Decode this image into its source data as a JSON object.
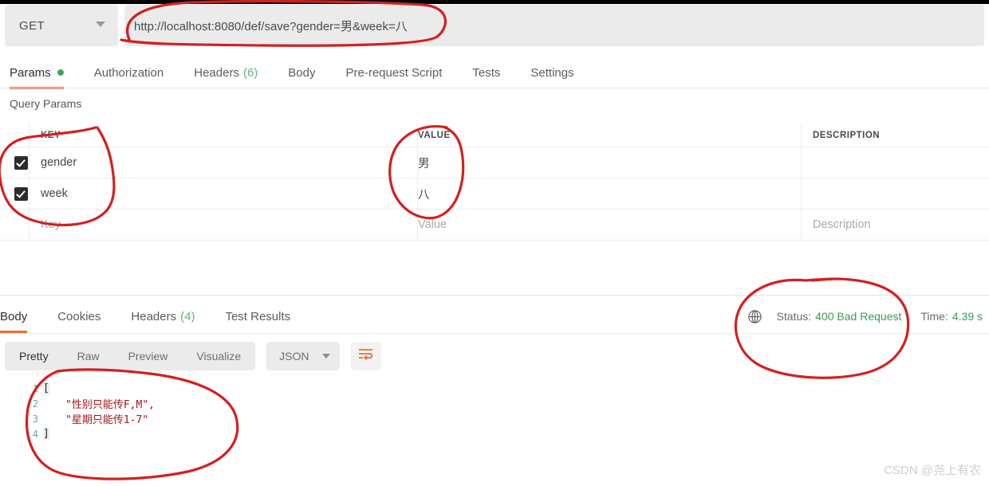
{
  "window": {
    "app": "postman-request-builder"
  },
  "request": {
    "method": "GET",
    "url": "http://localhost:8080/def/save?gender=男&week=八",
    "tabs": [
      {
        "label": "Params",
        "active": true,
        "dot": true
      },
      {
        "label": "Authorization",
        "active": false
      },
      {
        "label": "Headers",
        "count": "(6)",
        "active": false
      },
      {
        "label": "Body",
        "active": false
      },
      {
        "label": "Pre-request Script",
        "active": false
      },
      {
        "label": "Tests",
        "active": false
      },
      {
        "label": "Settings",
        "active": false
      }
    ],
    "section_label": "Query Params",
    "table": {
      "headers": [
        "KEY",
        "VALUE",
        "DESCRIPTION"
      ],
      "rows": [
        {
          "checked": true,
          "key": "gender",
          "value": "男",
          "description": ""
        },
        {
          "checked": true,
          "key": "week",
          "value": "八",
          "description": ""
        }
      ],
      "placeholder_row": {
        "key": "Key",
        "value": "Value",
        "description": "Description"
      }
    }
  },
  "response": {
    "tabs": [
      {
        "label": "Body",
        "active": true
      },
      {
        "label": "Cookies",
        "active": false
      },
      {
        "label": "Headers",
        "count": "(4)",
        "active": false
      },
      {
        "label": "Test Results",
        "active": false
      }
    ],
    "meta": {
      "globe_icon": "globe-icon",
      "status_label": "Status:",
      "status_value": "400 Bad Request",
      "time_label": "Time:",
      "time_value": "4.39 s"
    },
    "viewer": {
      "modes": [
        {
          "label": "Pretty",
          "active": true
        },
        {
          "label": "Raw",
          "active": false
        },
        {
          "label": "Preview",
          "active": false
        },
        {
          "label": "Visualize",
          "active": false
        }
      ],
      "format": "JSON",
      "wrap_icon": "wrap-lines-icon"
    },
    "body_lines": [
      {
        "n": "1",
        "bracket": "[",
        "text": ""
      },
      {
        "n": "2",
        "bracket": "",
        "text": "\"性别只能传F,M\","
      },
      {
        "n": "3",
        "bracket": "",
        "text": "\"星期只能传1-7\""
      },
      {
        "n": "4",
        "bracket": "]",
        "text": ""
      }
    ]
  },
  "watermark": "CSDN @尧上有农",
  "colors": {
    "accent_orange": "#ef6c33",
    "status_green": "#3c9c4e",
    "annotation_red": "#d32020",
    "chrome_grey": "#ebebeb"
  },
  "annotations": [
    {
      "name": "url-circle",
      "target": "request-url"
    },
    {
      "name": "params-circle",
      "target": "params-key-column"
    },
    {
      "name": "value-circle",
      "target": "params-value-column"
    },
    {
      "name": "status-circle",
      "target": "response-status"
    },
    {
      "name": "body-circle",
      "target": "response-body"
    }
  ]
}
